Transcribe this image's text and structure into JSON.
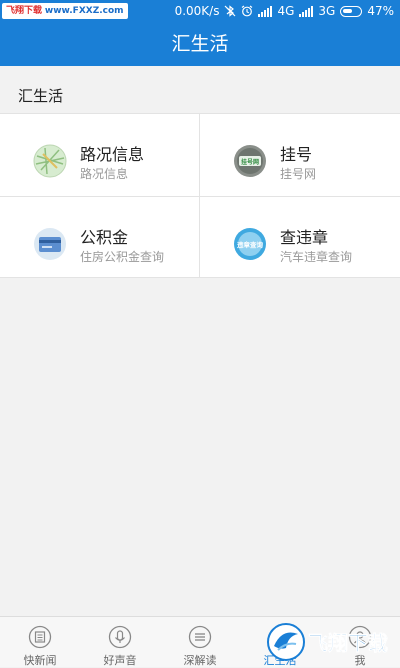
{
  "statusbar": {
    "watermark_left": "飞翔下载",
    "watermark_right": "www.FXXZ.com",
    "speed": "0.00K/s",
    "network1": "4G",
    "network2": "3G",
    "battery": "47%"
  },
  "appbar": {
    "title": "汇生活"
  },
  "section": {
    "title": "汇生活"
  },
  "services": [
    {
      "title": "路况信息",
      "subtitle": "路况信息",
      "icon": "map-icon"
    },
    {
      "title": "挂号",
      "subtitle": "挂号网",
      "icon": "registration-icon",
      "icon_text": "挂号网"
    },
    {
      "title": "公积金",
      "subtitle": "住房公积金查询",
      "icon": "card-icon"
    },
    {
      "title": "查违章",
      "subtitle": "汽车违章查询",
      "icon": "traffic-violation-icon",
      "icon_text": "违章查询"
    }
  ],
  "tabs": [
    {
      "label": "快新闻",
      "icon": "news-icon"
    },
    {
      "label": "好声音",
      "icon": "microphone-icon"
    },
    {
      "label": "深解读",
      "icon": "list-icon"
    },
    {
      "label": "汇生活",
      "icon": "life-icon",
      "active": true
    },
    {
      "label": "我",
      "icon": "person-icon"
    }
  ],
  "watermark_br": "飞翔下载",
  "colors": {
    "primary": "#1a7fd6",
    "background": "#f2f2f2"
  }
}
